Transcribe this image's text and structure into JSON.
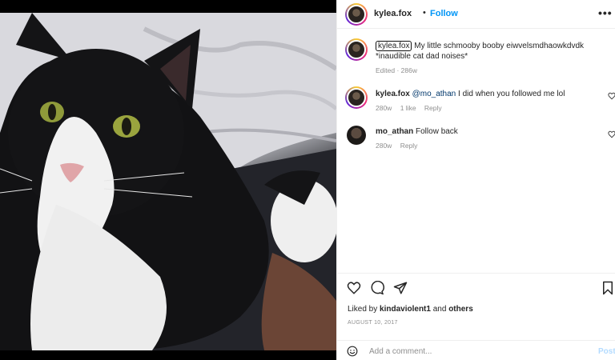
{
  "header": {
    "username": "kylea.fox",
    "separator": "•",
    "follow_label": "Follow",
    "more_icon": "more-horizontal-icon"
  },
  "caption": {
    "username": "kylea.fox",
    "text": " My little schmooby booby eiwvelsmdhaowkdvdk *inaudible cat dad noises*",
    "meta": "Edited · 286w"
  },
  "comments": [
    {
      "username": "kylea.fox",
      "mention": "@mo_athan",
      "text": " I did when you followed me lol",
      "age": "280w",
      "likes": "1 like",
      "reply": "Reply"
    },
    {
      "username": "mo_athan",
      "text": " Follow back",
      "age": "280w",
      "reply": "Reply"
    }
  ],
  "actions": {
    "icons": [
      "heart-icon",
      "comment-icon",
      "share-icon",
      "bookmark-icon"
    ]
  },
  "likes": {
    "prefix": "Liked by ",
    "user": "kindaviolent1",
    "middle": " and ",
    "others": "others"
  },
  "date": "AUGUST 10, 2017",
  "add_comment": {
    "placeholder": "Add a comment...",
    "post_label": "Post"
  },
  "colors": {
    "accent": "#0095f6",
    "text": "#262626",
    "muted": "#8e8e8e",
    "post_disabled": "#b3dbff"
  }
}
